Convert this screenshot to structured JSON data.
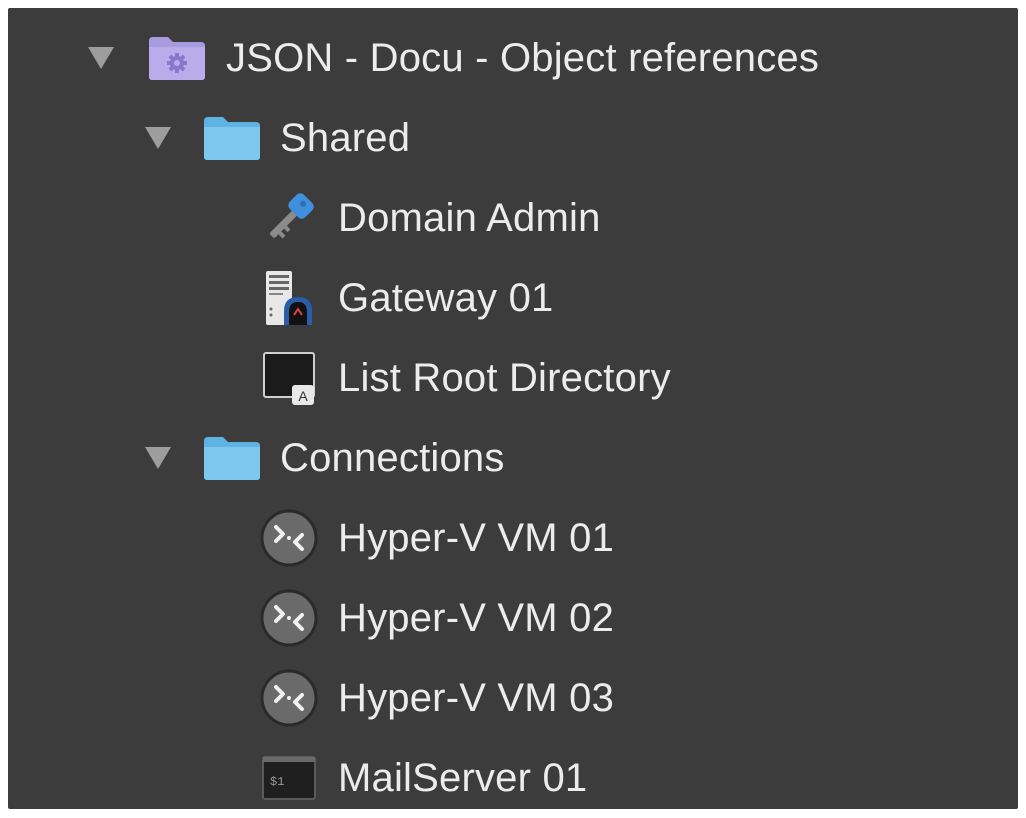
{
  "tree": {
    "root": {
      "label": "JSON - Docu - Object references",
      "icon": "settings-folder-icon",
      "expanded": true
    },
    "shared": {
      "label": "Shared",
      "icon": "folder-icon",
      "expanded": true,
      "items": [
        {
          "label": "Domain Admin",
          "icon": "key-credential-icon"
        },
        {
          "label": "Gateway 01",
          "icon": "gateway-server-icon"
        },
        {
          "label": "List Root Directory",
          "icon": "terminal-script-icon"
        }
      ]
    },
    "connections": {
      "label": "Connections",
      "icon": "folder-icon",
      "expanded": true,
      "items": [
        {
          "label": "Hyper-V VM 01",
          "icon": "remote-desktop-icon"
        },
        {
          "label": "Hyper-V VM 02",
          "icon": "remote-desktop-icon"
        },
        {
          "label": "Hyper-V VM 03",
          "icon": "remote-desktop-icon"
        },
        {
          "label": "MailServer 01",
          "icon": "terminal-session-icon"
        }
      ]
    }
  },
  "colors": {
    "background": "#3c3c3c",
    "text": "#ececec",
    "disclosure": "#9d9d9d",
    "folder": "#7ec8ef",
    "root_folder": "#a99be0"
  }
}
